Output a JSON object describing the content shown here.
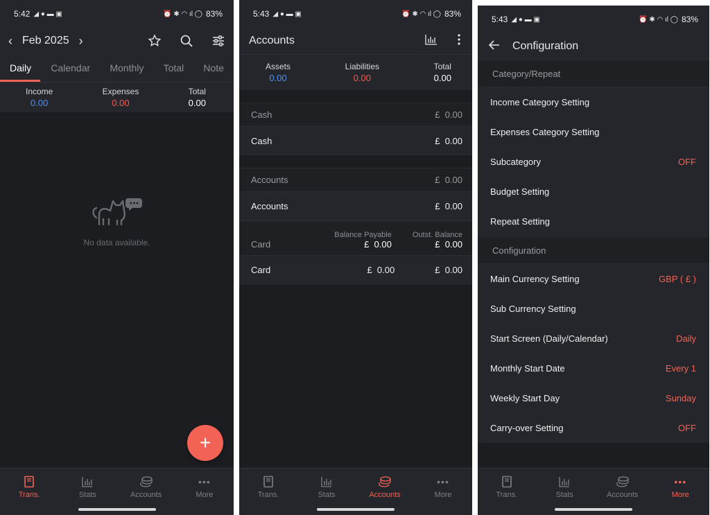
{
  "colors": {
    "accent": "#f36355",
    "income_blue": "#4f8ef2",
    "expense_red": "#f35a4f",
    "background": "#1c1d21"
  },
  "screen1": {
    "status": {
      "time": "5:42",
      "battery": "83%"
    },
    "header": {
      "month": "Feb 2025",
      "prev_icon": "chevron-left",
      "next_icon": "chevron-right"
    },
    "tabs": [
      "Daily",
      "Calendar",
      "Monthly",
      "Total",
      "Note"
    ],
    "summary": {
      "income_label": "Income",
      "income_value": "0.00",
      "expenses_label": "Expenses",
      "expenses_value": "0.00",
      "total_label": "Total",
      "total_value": "0.00"
    },
    "empty_text": "No data available.",
    "fab_label": "+",
    "nav": [
      "Trans.",
      "Stats",
      "Accounts",
      "More"
    ]
  },
  "screen2": {
    "status": {
      "time": "5:43",
      "battery": "83%"
    },
    "title": "Accounts",
    "summary": {
      "assets_label": "Assets",
      "assets_value": "0.00",
      "liabilities_label": "Liabilities",
      "liabilities_value": "0.00",
      "total_label": "Total",
      "total_value": "0.00"
    },
    "groups": {
      "cash": {
        "name": "Cash",
        "amount": "£  0.00",
        "item": "Cash",
        "item_amount": "£  0.00"
      },
      "accounts": {
        "name": "Accounts",
        "amount": "£  0.00",
        "item": "Accounts",
        "item_amount": "£  0.00"
      },
      "card": {
        "name": "Card",
        "balance_payable_label": "Balance Payable",
        "balance_payable": "£  0.00",
        "outst_label": "Outst. Balance",
        "outst": "£  0.00",
        "item": "Card",
        "item_payable": "£  0.00",
        "item_outst": "£  0.00"
      }
    },
    "nav": [
      "Trans.",
      "Stats",
      "Accounts",
      "More"
    ]
  },
  "screen3": {
    "status": {
      "time": "5:43",
      "battery": "83%"
    },
    "title": "Configuration",
    "section1": "Category/Repeat",
    "section1_items": [
      {
        "label": "Income Category Setting",
        "value": ""
      },
      {
        "label": "Expenses Category Setting",
        "value": ""
      },
      {
        "label": "Subcategory",
        "value": "OFF"
      },
      {
        "label": "Budget Setting",
        "value": ""
      },
      {
        "label": "Repeat Setting",
        "value": ""
      }
    ],
    "section2": "Configuration",
    "section2_items": [
      {
        "label": "Main Currency Setting",
        "value": "GBP ( £ )"
      },
      {
        "label": "Sub Currency Setting",
        "value": ""
      },
      {
        "label": "Start Screen (Daily/Calendar)",
        "value": "Daily"
      },
      {
        "label": "Monthly Start Date",
        "value": "Every 1"
      },
      {
        "label": "Weekly Start Day",
        "value": "Sunday"
      },
      {
        "label": "Carry-over Setting",
        "value": "OFF"
      }
    ],
    "nav": [
      "Trans.",
      "Stats",
      "Accounts",
      "More"
    ]
  }
}
